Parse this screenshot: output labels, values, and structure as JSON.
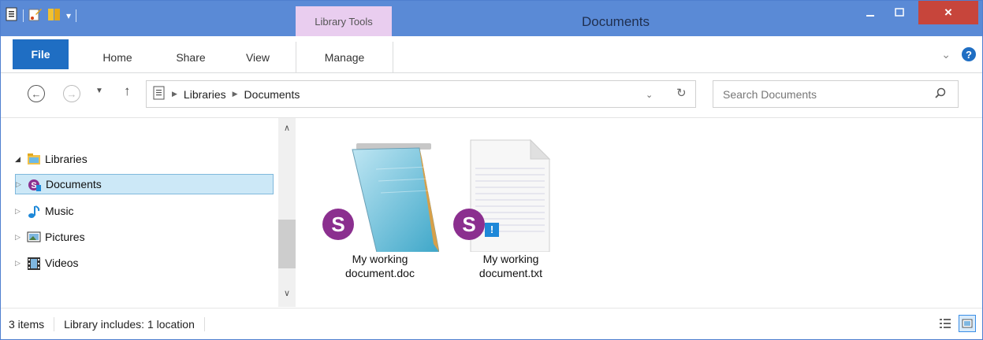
{
  "window": {
    "title": "Documents",
    "context_tab": "Library Tools",
    "close_glyph": "×"
  },
  "ribbon": {
    "tabs": [
      {
        "label": "File"
      },
      {
        "label": "Home"
      },
      {
        "label": "Share"
      },
      {
        "label": "View"
      },
      {
        "label": "Manage"
      }
    ],
    "help_glyph": "?",
    "expand_glyph": "⌄"
  },
  "address": {
    "crumbs": [
      "Libraries",
      "Documents"
    ],
    "dropdown_glyph": "⌄",
    "refresh_glyph": "↻"
  },
  "search": {
    "placeholder": "Search Documents"
  },
  "nav": {
    "root": "Libraries",
    "items": [
      {
        "label": "Documents",
        "icon": "documents-library-icon",
        "selected": true
      },
      {
        "label": "Music",
        "icon": "music-icon"
      },
      {
        "label": "Pictures",
        "icon": "pictures-icon"
      },
      {
        "label": "Videos",
        "icon": "videos-icon"
      }
    ]
  },
  "files": [
    {
      "name_line1": "My working",
      "name_line2": "document.doc",
      "icon": "notepad-icon",
      "badge": "S",
      "warning": false
    },
    {
      "name_line1": "My working",
      "name_line2": "document.txt",
      "icon": "text-file-icon",
      "badge": "S",
      "warning": true,
      "warning_glyph": "!"
    }
  ],
  "status": {
    "item_count": "3 items",
    "library_info": "Library includes: 1 location"
  },
  "colors": {
    "titlebar": "#5a8ad6",
    "file_tab": "#1f6ec3",
    "context_tab": "#e9cdef",
    "close_button": "#c7453b",
    "selection": "#cce8f7",
    "badge": "#8b2f8f"
  }
}
